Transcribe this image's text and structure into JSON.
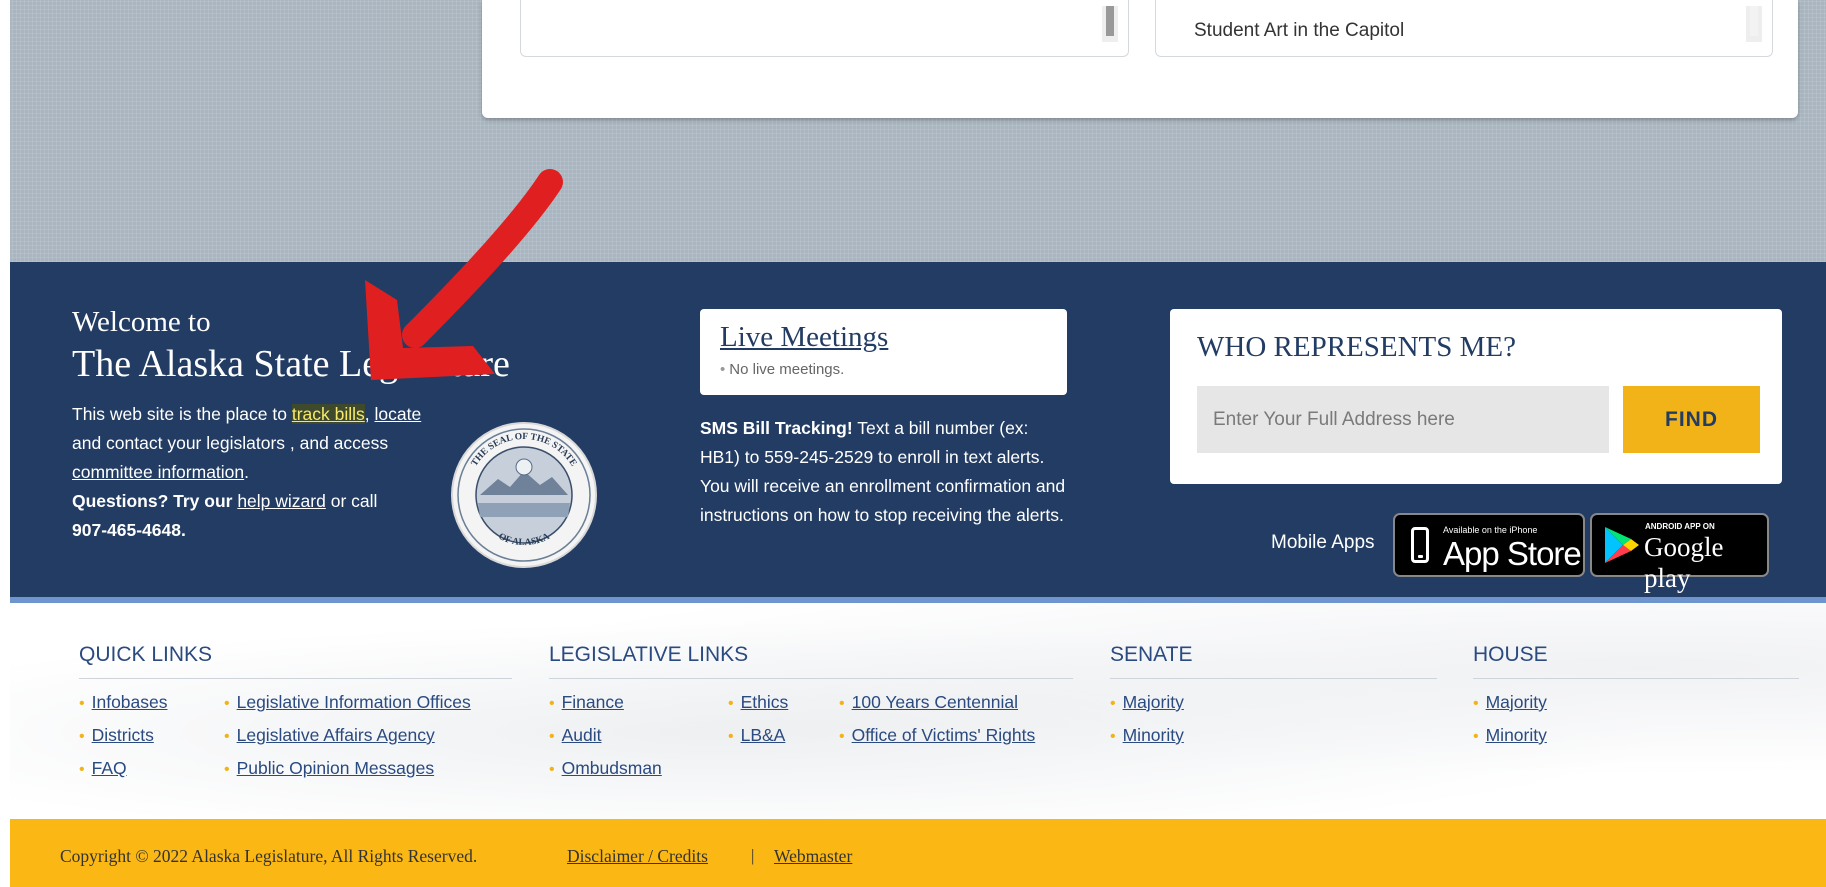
{
  "top_card": {
    "right_item": "Student Art in the Capitol"
  },
  "welcome": {
    "line1": "Welcome to",
    "line2": "The Alaska State Legislature",
    "intro_prefix": "This web site is the place to ",
    "track_bills": "track bills",
    "locate": "locate",
    "contact_text": " and contact your legislators , and access ",
    "committee_info": "committee information",
    "questions": "Questions? Try our",
    "help_wizard": "help wizard",
    "or_call": " or call ",
    "phone": "907-465-4648."
  },
  "live_meetings": {
    "title": "Live Meetings",
    "status": "No live meetings."
  },
  "sms": {
    "bold": "SMS Bill Tracking!",
    "text": " Text a bill number (ex: HB1) to 559-245-2529 to enroll in text alerts. You will receive an enrollment confirmation and instructions on how to stop receiving the alerts."
  },
  "who_represents": {
    "title": "WHO REPRESENTS ME?",
    "placeholder": "Enter Your Full Address here",
    "button": "FIND"
  },
  "mobile_apps": {
    "label": "Mobile Apps",
    "apple_small": "Available on the iPhone",
    "apple_big": "App Store",
    "google_small": "ANDROID APP ON",
    "google_big": "Google play"
  },
  "footer_links": {
    "quick_links": {
      "heading": "QUICK LINKS",
      "items": [
        "Infobases",
        "Districts",
        "FAQ",
        "Legislative Information Offices",
        "Legislative Affairs Agency",
        "Public Opinion Messages"
      ]
    },
    "legislative_links": {
      "heading": "LEGISLATIVE LINKS",
      "items": [
        "Finance",
        "Audit",
        "Ombudsman",
        "Ethics",
        "LB&A",
        "100 Years Centennial",
        "Office of Victims' Rights"
      ]
    },
    "senate": {
      "heading": "SENATE",
      "items": [
        "Majority",
        "Minority"
      ]
    },
    "house": {
      "heading": "HOUSE",
      "items": [
        "Majority",
        "Minority"
      ]
    }
  },
  "copyright": {
    "text": "Copyright © 2022 Alaska Legislature, All Rights Reserved.",
    "disclaimer": "Disclaimer / Credits",
    "separator": "|",
    "webmaster": "Webmaster"
  },
  "colors": {
    "navy": "#223c63",
    "accent_yellow": "#fbb814",
    "annotation_red": "#e02020"
  },
  "seal_text": {
    "top": "THE SEAL OF THE STATE",
    "bottom": "OF ALASKA"
  }
}
